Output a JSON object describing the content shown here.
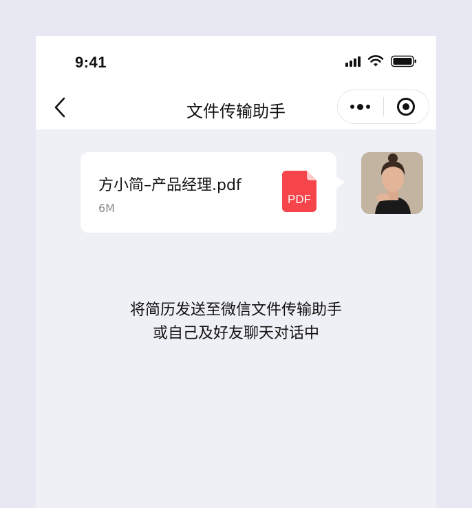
{
  "status_bar": {
    "time": "9:41"
  },
  "nav": {
    "title": "文件传输助手"
  },
  "message": {
    "file_name": "方小简–产品经理.pdf",
    "file_size": "6M",
    "file_type_label": "PDF",
    "icon": "pdf-file-icon"
  },
  "hint": {
    "line1": "将简历发送至微信文件传输助手",
    "line2": "或自己及好友聊天对话中"
  },
  "colors": {
    "pdf_red": "#f5454b",
    "background": "#eff0f5",
    "page_background": "#e7e8f2"
  }
}
